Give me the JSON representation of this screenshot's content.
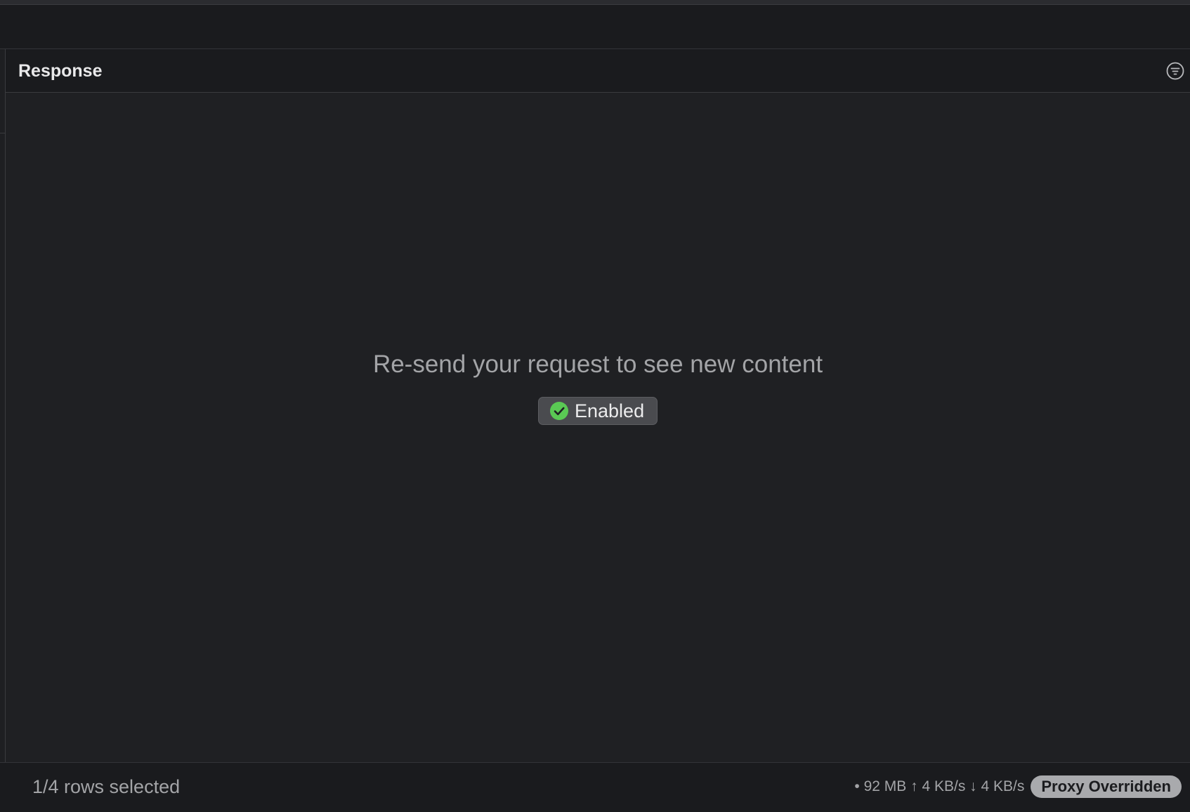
{
  "response_panel": {
    "title": "Response",
    "filter_icon": "filter-circle-icon",
    "empty_message": "Re-send your request to see new content",
    "badge": {
      "label": "Enabled",
      "icon": "check-circle-icon",
      "icon_color": "#5ac954"
    }
  },
  "status_bar": {
    "rows_selected": "1/4 rows selected",
    "network_stats": "• 92 MB ↑ 4 KB/s ↓ 4 KB/s",
    "proxy_badge": "Proxy Overridden"
  }
}
